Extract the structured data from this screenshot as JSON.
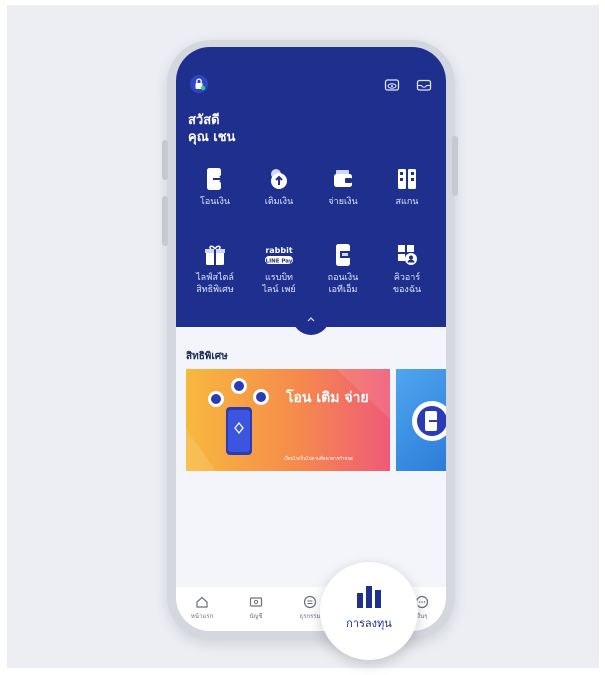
{
  "header": {
    "greeting_line1": "สวัสดี",
    "greeting_line2": "คุณ เชน",
    "lock_icon": "lock-icon",
    "eye_icon": "eye-hidden-icon",
    "mail_icon": "mail-icon",
    "background_color": "#1e2f8e"
  },
  "menu": [
    {
      "label": "โอนเงิน",
      "icon": "transfer-icon"
    },
    {
      "label": "เติมเงิน",
      "icon": "topup-icon"
    },
    {
      "label": "จ่ายเงิน",
      "icon": "wallet-icon"
    },
    {
      "label": "สแกน",
      "icon": "scan-icon"
    },
    {
      "label": "ไลฟ์สไตล์\nสิทธิพิเศษ",
      "icon": "gift-icon"
    },
    {
      "label": "แรบบิท\nไลน์ เพย์",
      "icon": "rabbit-line-pay-icon",
      "logo_text": "rabbit",
      "logo_sub": "LINE Pay"
    },
    {
      "label": "ถอนเงิน\nเอทีเอ็ม",
      "icon": "atm-withdraw-icon"
    },
    {
      "label": "คิวอาร์\nของฉัน",
      "icon": "my-qr-icon"
    }
  ],
  "privileges": {
    "title": "สิทธิพิเศษ",
    "banner_title": "โอน เติม จ่าย",
    "banner_note": "เงื่อนไขเป็นไปตามที่ธนาคารกำหนด"
  },
  "tabs": [
    {
      "label": "หน้าแรก",
      "icon": "home-icon"
    },
    {
      "label": "บัญชี",
      "icon": "account-icon"
    },
    {
      "label": "ธุรกรรม",
      "icon": "transaction-icon"
    },
    {
      "label": "การลงทุน",
      "icon": "invest-chart-icon",
      "active": true
    },
    {
      "label": "อื่นๆ",
      "icon": "more-icon"
    }
  ],
  "highlighted_tab": "การลงทุน",
  "accent_color": "#1e2f8e"
}
